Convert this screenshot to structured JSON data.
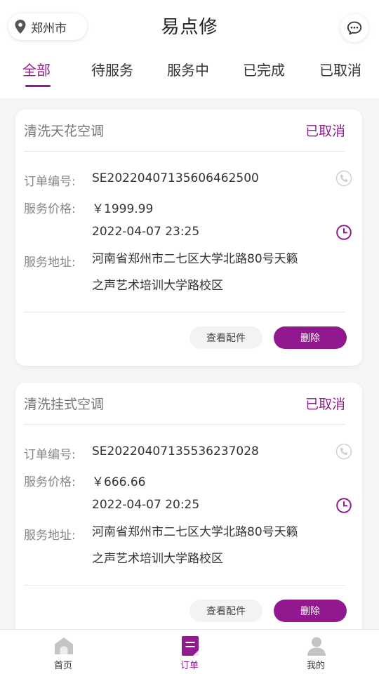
{
  "header": {
    "location": "郑州市",
    "title": "易点修",
    "icons": {
      "location": "location-pin-icon",
      "message": "message-bubble-icon"
    }
  },
  "tabs": [
    {
      "label": "全部",
      "active": true
    },
    {
      "label": "待服务",
      "active": false
    },
    {
      "label": "服务中",
      "active": false
    },
    {
      "label": "已完成",
      "active": false
    },
    {
      "label": "已取消",
      "active": false
    }
  ],
  "labels": {
    "order_no": "订单编号:",
    "price": "服务价格:",
    "address": "服务地址:"
  },
  "orders": [
    {
      "service": "清洗天花空调",
      "status": "已取消",
      "order_no": "SE20220407135606462500",
      "price": "￥1999.99",
      "time": "2022-04-07 23:25",
      "address_line1": "河南省郑州市二七区大学北路80号天籁",
      "address_line2": "之声艺术培训大学路校区",
      "view_parts": "查看配件",
      "delete": "删除"
    },
    {
      "service": "清洗挂式空调",
      "status": "已取消",
      "order_no": "SE20220407135536237028",
      "price": "￥666.66",
      "time": "2022-04-07 20:25",
      "address_line1": "河南省郑州市二七区大学北路80号天籁",
      "address_line2": "之声艺术培训大学路校区",
      "view_parts": "查看配件",
      "delete": "删除"
    }
  ],
  "nav": [
    {
      "label": "首页",
      "icon": "home-icon",
      "active": false
    },
    {
      "label": "订单",
      "icon": "orders-icon",
      "active": true
    },
    {
      "label": "我的",
      "icon": "profile-icon",
      "active": false
    }
  ],
  "colors": {
    "accent": "#8e1c8e",
    "delete_button": "#92188f"
  }
}
